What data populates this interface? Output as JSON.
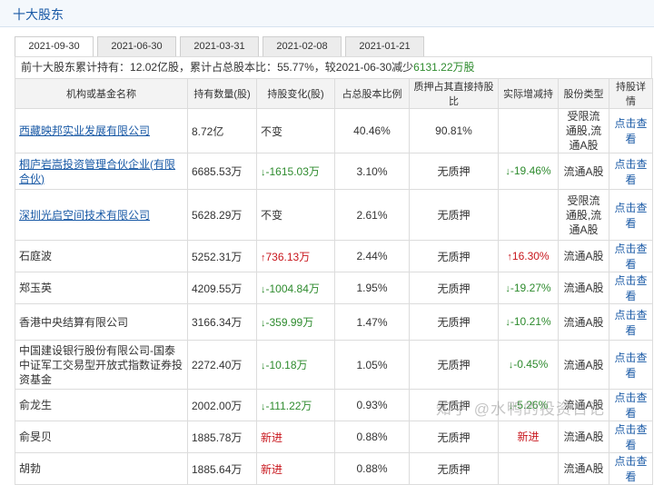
{
  "section": {
    "title": "十大股东"
  },
  "tabs": [
    "2021-09-30",
    "2021-06-30",
    "2021-03-31",
    "2021-02-08",
    "2021-01-21"
  ],
  "summary": {
    "prefix": "前十大股东累计持有：",
    "shares": "12.02亿股",
    "mid": "，累计占总股本比：",
    "ratio": "55.77%",
    "comp": "，较2021-06-30减少",
    "change": "6131.22万股"
  },
  "columns": [
    "机构或基金名称",
    "持有数量(股)",
    "持股变化(股)",
    "占总股本比例",
    "质押占其直接持股比",
    "实际增减持",
    "股份类型",
    "持股详情"
  ],
  "rows": [
    {
      "name": "西藏映邦实业发展有限公司",
      "link": true,
      "qty": "8.72亿",
      "change": "不变",
      "dir": "none",
      "ratio": "40.46%",
      "pledge": "90.81%",
      "actual": "",
      "actual_dir": "none",
      "type": "受限流通股,流通A股",
      "detail": "点击查看"
    },
    {
      "name": "桐庐岩嵩投资管理合伙企业(有限合伙)",
      "link": true,
      "qty": "6685.53万",
      "change": "-1615.03万",
      "dir": "down",
      "ratio": "3.10%",
      "pledge": "无质押",
      "actual": "-19.46%",
      "actual_dir": "down",
      "type": "流通A股",
      "detail": "点击查看"
    },
    {
      "name": "深圳光启空间技术有限公司",
      "link": true,
      "qty": "5628.29万",
      "change": "不变",
      "dir": "none",
      "ratio": "2.61%",
      "pledge": "无质押",
      "actual": "",
      "actual_dir": "none",
      "type": "受限流通股,流通A股",
      "detail": "点击查看"
    },
    {
      "name": "石庭波",
      "link": false,
      "qty": "5252.31万",
      "change": "736.13万",
      "dir": "up",
      "ratio": "2.44%",
      "pledge": "无质押",
      "actual": "16.30%",
      "actual_dir": "up",
      "type": "流通A股",
      "detail": "点击查看"
    },
    {
      "name": "郑玉英",
      "link": false,
      "qty": "4209.55万",
      "change": "-1004.84万",
      "dir": "down",
      "ratio": "1.95%",
      "pledge": "无质押",
      "actual": "-19.27%",
      "actual_dir": "down",
      "type": "流通A股",
      "detail": "点击查看"
    },
    {
      "name": "香港中央结算有限公司",
      "link": false,
      "qty": "3166.34万",
      "change": "-359.99万",
      "dir": "down",
      "ratio": "1.47%",
      "pledge": "无质押",
      "actual": "-10.21%",
      "actual_dir": "down",
      "type": "流通A股",
      "detail": "点击查看"
    },
    {
      "name": "中国建设银行股份有限公司-国泰中证军工交易型开放式指数证券投资基金",
      "link": false,
      "qty": "2272.40万",
      "change": "-10.18万",
      "dir": "down",
      "ratio": "1.05%",
      "pledge": "无质押",
      "actual": "-0.45%",
      "actual_dir": "down",
      "type": "流通A股",
      "detail": "点击查看"
    },
    {
      "name": "俞龙生",
      "link": false,
      "qty": "2002.00万",
      "change": "-111.22万",
      "dir": "down",
      "ratio": "0.93%",
      "pledge": "无质押",
      "actual": "-5.26%",
      "actual_dir": "down",
      "type": "流通A股",
      "detail": "点击查看"
    },
    {
      "name": "俞旻贝",
      "link": false,
      "qty": "1885.78万",
      "change": "新进",
      "dir": "new",
      "ratio": "0.88%",
      "pledge": "无质押",
      "actual": "新进",
      "actual_dir": "new",
      "type": "流通A股",
      "detail": "点击查看"
    },
    {
      "name": "胡勃",
      "link": false,
      "qty": "1885.64万",
      "change": "新进",
      "dir": "new",
      "ratio": "0.88%",
      "pledge": "无质押",
      "actual": "",
      "actual_dir": "none",
      "type": "流通A股",
      "detail": "点击查看"
    }
  ],
  "watermark": "知乎 @水鸭的投资日记",
  "colors": {
    "link": "#1a5aa6",
    "down": "#2e8b2e",
    "up": "#c8161d",
    "header_bg": "#f3f3f3"
  },
  "icons": {
    "down": "down-arrow-icon",
    "up": "up-arrow-icon"
  }
}
